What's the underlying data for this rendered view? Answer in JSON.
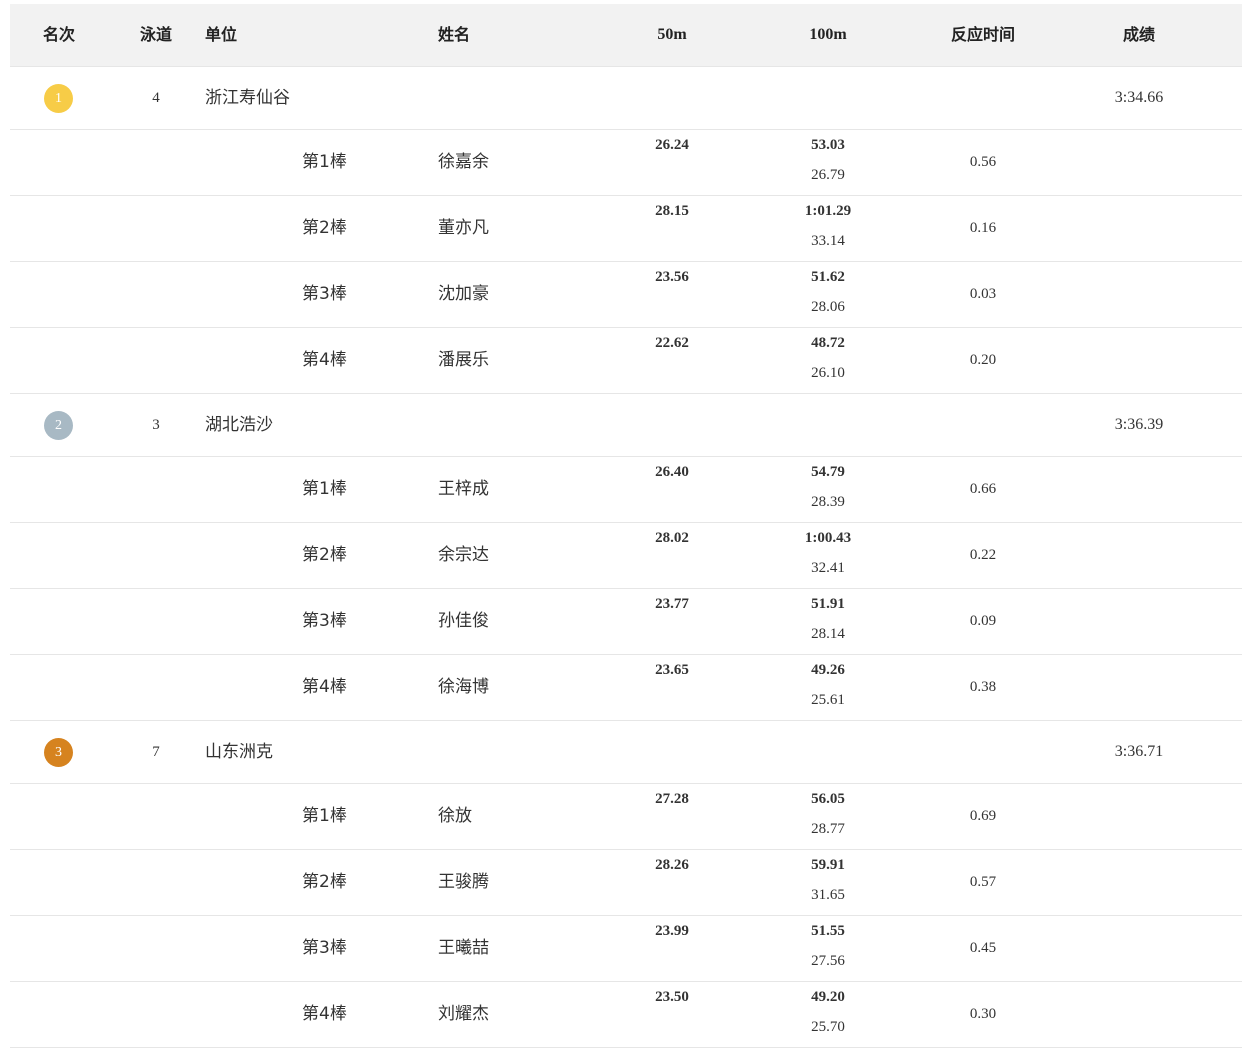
{
  "header": {
    "rank": "名次",
    "lane": "泳道",
    "team": "单位",
    "name": "姓名",
    "split50": "50m",
    "split100": "100m",
    "reaction": "反应时间",
    "result": "成绩"
  },
  "medal_colors": {
    "gold": "#f7cc47",
    "silver": "#a8b9c4",
    "bronze": "#d6831f"
  },
  "teams": [
    {
      "rank": "1",
      "medal": "gold",
      "lane": "4",
      "team": "浙江寿仙谷",
      "result": "3:34.66",
      "legs": [
        {
          "leg": "第1棒",
          "name": "徐嘉余",
          "split50": "26.24",
          "split100": "53.03",
          "leg_time": "26.79",
          "reaction": "0.56"
        },
        {
          "leg": "第2棒",
          "name": "董亦凡",
          "split50": "28.15",
          "split100": "1:01.29",
          "leg_time": "33.14",
          "reaction": "0.16"
        },
        {
          "leg": "第3棒",
          "name": "沈加豪",
          "split50": "23.56",
          "split100": "51.62",
          "leg_time": "28.06",
          "reaction": "0.03"
        },
        {
          "leg": "第4棒",
          "name": "潘展乐",
          "split50": "22.62",
          "split100": "48.72",
          "leg_time": "26.10",
          "reaction": "0.20"
        }
      ]
    },
    {
      "rank": "2",
      "medal": "silver",
      "lane": "3",
      "team": "湖北浩沙",
      "result": "3:36.39",
      "legs": [
        {
          "leg": "第1棒",
          "name": "王梓成",
          "split50": "26.40",
          "split100": "54.79",
          "leg_time": "28.39",
          "reaction": "0.66"
        },
        {
          "leg": "第2棒",
          "name": "余宗达",
          "split50": "28.02",
          "split100": "1:00.43",
          "leg_time": "32.41",
          "reaction": "0.22"
        },
        {
          "leg": "第3棒",
          "name": "孙佳俊",
          "split50": "23.77",
          "split100": "51.91",
          "leg_time": "28.14",
          "reaction": "0.09"
        },
        {
          "leg": "第4棒",
          "name": "徐海博",
          "split50": "23.65",
          "split100": "49.26",
          "leg_time": "25.61",
          "reaction": "0.38"
        }
      ]
    },
    {
      "rank": "3",
      "medal": "bronze",
      "lane": "7",
      "team": "山东洲克",
      "result": "3:36.71",
      "legs": [
        {
          "leg": "第1棒",
          "name": "徐放",
          "split50": "27.28",
          "split100": "56.05",
          "leg_time": "28.77",
          "reaction": "0.69"
        },
        {
          "leg": "第2棒",
          "name": "王骏腾",
          "split50": "28.26",
          "split100": "59.91",
          "leg_time": "31.65",
          "reaction": "0.57"
        },
        {
          "leg": "第3棒",
          "name": "王曦喆",
          "split50": "23.99",
          "split100": "51.55",
          "leg_time": "27.56",
          "reaction": "0.45"
        },
        {
          "leg": "第4棒",
          "name": "刘耀杰",
          "split50": "23.50",
          "split100": "49.20",
          "leg_time": "25.70",
          "reaction": "0.30"
        }
      ]
    }
  ]
}
